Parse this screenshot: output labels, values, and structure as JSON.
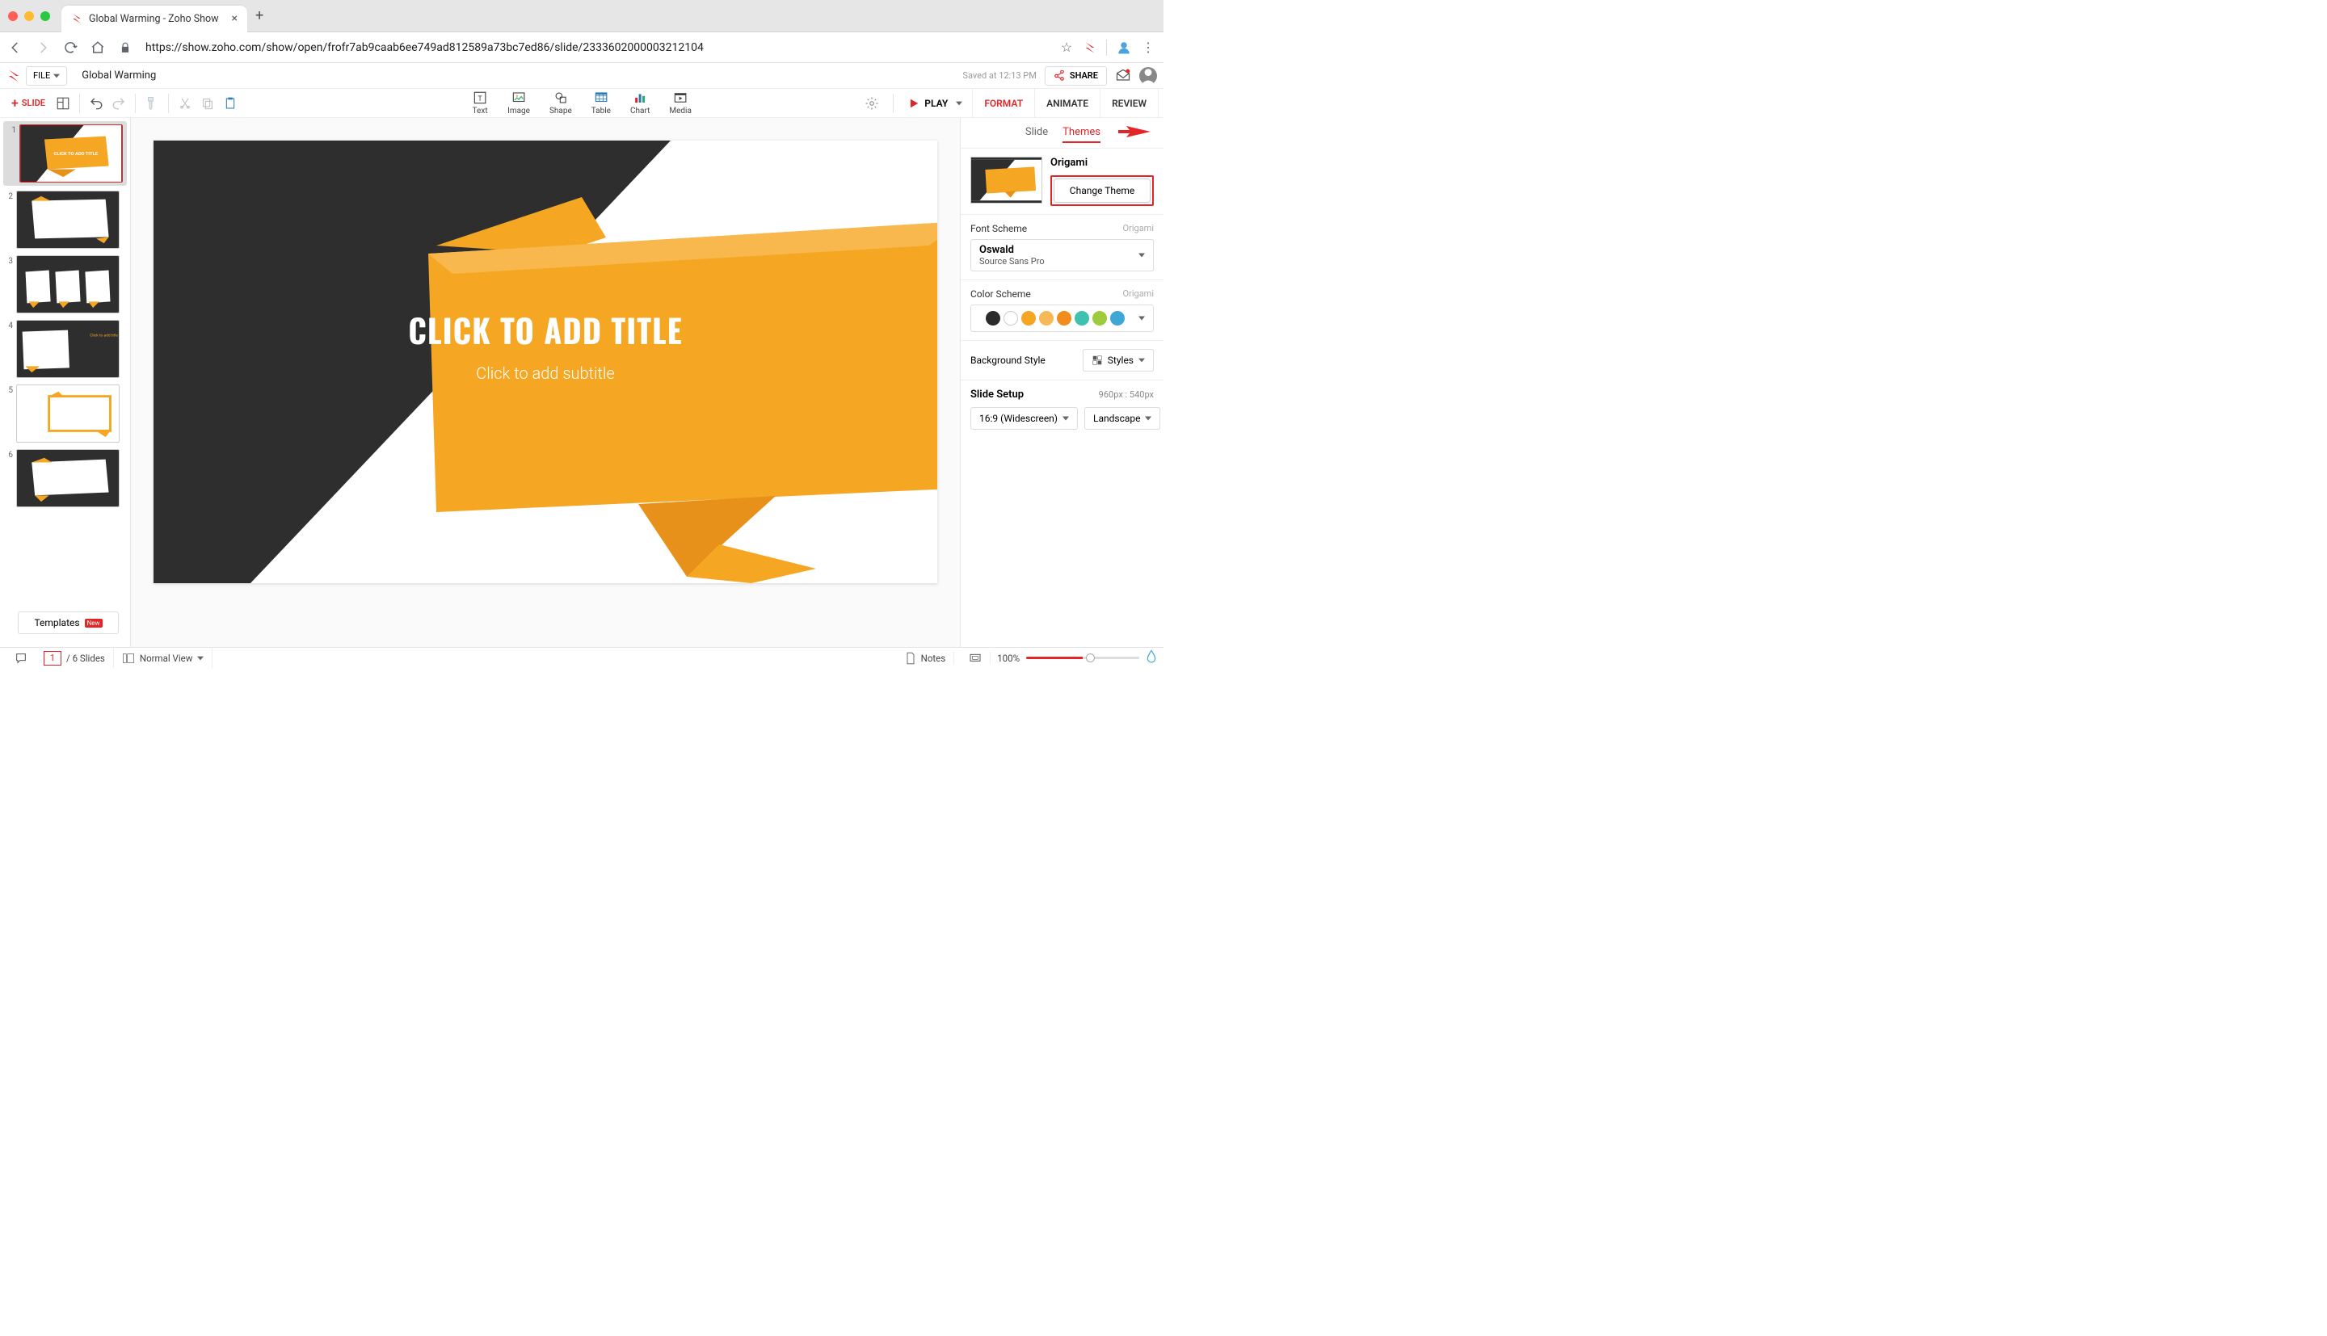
{
  "browser": {
    "tab_title": "Global Warming - Zoho Show",
    "url": "https://show.zoho.com/show/open/frofr7ab9caab6ee749ad812589a73bc7ed86/slide/2333602000003212104"
  },
  "header": {
    "file_menu": "FILE",
    "doc_title": "Global Warming",
    "saved_text": "Saved at 12:13 PM",
    "share_label": "SHARE"
  },
  "toolbar": {
    "add_slide": "SLIDE",
    "insert": {
      "text": "Text",
      "image": "Image",
      "shape": "Shape",
      "table": "Table",
      "chart": "Chart",
      "media": "Media"
    },
    "play_label": "PLAY",
    "panel_tabs": {
      "format": "FORMAT",
      "animate": "ANIMATE",
      "review": "REVIEW"
    }
  },
  "thumbnails": {
    "count": 6,
    "templates_label": "Templates",
    "templates_badge": "New"
  },
  "slide": {
    "title_placeholder": "CLICK TO ADD TITLE",
    "subtitle_placeholder": "Click to add subtitle"
  },
  "right_panel": {
    "subtabs": {
      "slide": "Slide",
      "themes": "Themes"
    },
    "theme_name": "Origami",
    "change_theme": "Change Theme",
    "font_scheme": {
      "label": "Font Scheme",
      "hint": "Origami",
      "heading": "Oswald",
      "body": "Source Sans Pro"
    },
    "color_scheme": {
      "label": "Color Scheme",
      "hint": "Origami",
      "colors": [
        "#2b2b2b",
        "#ffffff",
        "#f5a623",
        "#f7b955",
        "#f28c1c",
        "#3fc1b0",
        "#9ecb3c",
        "#3fa7d6"
      ]
    },
    "background": {
      "label": "Background Style",
      "styles_btn": "Styles"
    },
    "slide_setup": {
      "label": "Slide Setup",
      "dims": "960px : 540px",
      "ratio": "16:9 (Widescreen)",
      "orient": "Landscape"
    }
  },
  "status": {
    "page": "1",
    "total": "/ 6 Slides",
    "view": "Normal View",
    "notes": "Notes",
    "zoom": "100%"
  }
}
